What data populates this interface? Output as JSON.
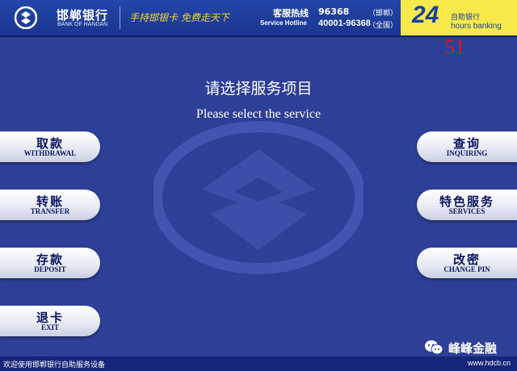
{
  "header": {
    "brand_cn": "邯郸银行",
    "brand_en": "BANK OF HANDAN",
    "slogan": "手持邯银卡 免费走天下",
    "hotline_cn_label": "客服热线",
    "hotline_cn_number": "96368",
    "hotline_cn_note": "（邯郸）",
    "hotline_en_label": "Service Hotline",
    "hotline_en_number": "40001-96368",
    "hotline_en_note": "（全国）",
    "badge_number": "24",
    "badge_cn": "自助银行",
    "badge_en": "hours banking"
  },
  "timer": "51",
  "prompt": {
    "cn": "请选择服务项目",
    "en": "Please select the service"
  },
  "buttons": {
    "withdrawal": {
      "cn": "取款",
      "en": "WITHDRAWAL"
    },
    "transfer": {
      "cn": "转账",
      "en": "TRANSFER"
    },
    "deposit": {
      "cn": "存款",
      "en": "DEPOSIT"
    },
    "exit": {
      "cn": "退卡",
      "en": "EXIT"
    },
    "inquiring": {
      "cn": "查询",
      "en": "INQUIRING"
    },
    "services": {
      "cn": "特色服务",
      "en": "SERVICES"
    },
    "change_pin": {
      "cn": "改密",
      "en": "CHANGE PIN"
    }
  },
  "footer": {
    "text": "欢迎使用邯郸银行自助服务设备",
    "url": "www.hdcb.cn"
  },
  "overlay": {
    "wechat_label": "峰峰金融"
  },
  "colors": {
    "background": "#2d3f96",
    "header": "#1a3590",
    "badge_yellow": "#f7e94a",
    "timer_red": "#e0161c",
    "button_text": "#0a1560"
  }
}
